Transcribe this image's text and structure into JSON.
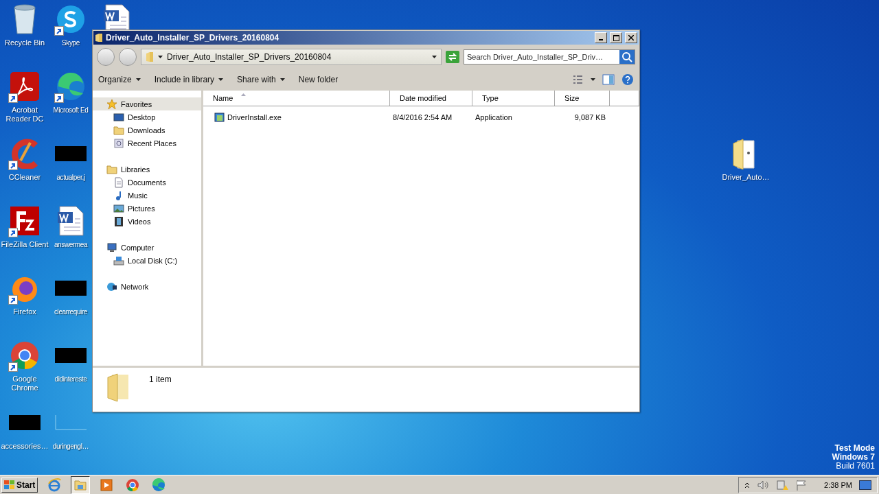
{
  "desktop": {
    "columns": [
      [
        {
          "label": "Recycle Bin",
          "kind": "recycle",
          "shortcut": false
        },
        {
          "label": "Acrobat Reader DC",
          "kind": "acrobat",
          "shortcut": true
        },
        {
          "label": "CCleaner",
          "kind": "ccleaner",
          "shortcut": true
        },
        {
          "label": "FileZilla Client",
          "kind": "filezilla",
          "shortcut": true
        },
        {
          "label": "Firefox",
          "kind": "firefox",
          "shortcut": true
        },
        {
          "label": "Google Chrome",
          "kind": "chrome",
          "shortcut": true
        },
        {
          "label": "accessories…",
          "kind": "image",
          "shortcut": false
        }
      ],
      [
        {
          "label": "Skype",
          "kind": "skype",
          "shortcut": true
        },
        {
          "label": "Microsoft Ed",
          "kind": "edge",
          "shortcut": true
        },
        {
          "label": "actualper.j",
          "kind": "image",
          "shortcut": false
        },
        {
          "label": "answermea",
          "kind": "word",
          "shortcut": false
        },
        {
          "label": "clearrequire",
          "kind": "image",
          "shortcut": false
        },
        {
          "label": "didintereste",
          "kind": "image",
          "shortcut": false
        },
        {
          "label": "duringengl…",
          "kind": "blank",
          "shortcut": false
        }
      ],
      [
        {
          "kind": "word",
          "shortcut": false
        }
      ]
    ],
    "right_icon": {
      "label": "Driver_Auto…",
      "kind": "folder",
      "shortcut": false
    },
    "system_text": [
      "Test Mode",
      "Windows 7",
      "Build 7601"
    ]
  },
  "window": {
    "title": "Driver_Auto_Installer_SP_Drivers_20160804",
    "address": "Driver_Auto_Installer_SP_Drivers_20160804",
    "search": {
      "placeholder": "Search Driver_Auto_Installer_SP_Driv…"
    },
    "toolbar": [
      {
        "label": "Organize",
        "dropdown": true
      },
      {
        "label": "Include in library",
        "dropdown": true
      },
      {
        "label": "Share with",
        "dropdown": true
      },
      {
        "label": "New folder",
        "dropdown": false
      }
    ],
    "nav": [
      {
        "label": "Favorites",
        "kind": "star",
        "selected": true,
        "children": [
          {
            "label": "Desktop",
            "kind": "desktop",
            "selected": false
          },
          {
            "label": "Downloads",
            "kind": "downloads",
            "selected": false
          },
          {
            "label": "Recent Places",
            "kind": "recent",
            "selected": false
          }
        ]
      },
      {
        "label": "Libraries",
        "kind": "libraries",
        "selected": false,
        "children": [
          {
            "label": "Documents",
            "kind": "documents",
            "selected": false
          },
          {
            "label": "Music",
            "kind": "music",
            "selected": false
          },
          {
            "label": "Pictures",
            "kind": "pictures",
            "selected": false
          },
          {
            "label": "Videos",
            "kind": "videos",
            "selected": false
          }
        ]
      },
      {
        "label": "Computer",
        "kind": "computer",
        "selected": false,
        "children": [
          {
            "label": "Local Disk (C:)",
            "kind": "disk",
            "selected": false
          }
        ]
      },
      {
        "label": "Network",
        "kind": "network",
        "selected": false
      }
    ],
    "columns": [
      {
        "label": "Name",
        "sorted": true
      },
      {
        "label": "Date modified",
        "sorted": false
      },
      {
        "label": "Type",
        "sorted": false
      },
      {
        "label": "Size",
        "sorted": false
      }
    ],
    "rows": [
      {
        "name": "DriverInstall.exe",
        "date": "8/4/2016 2:54 AM",
        "type": "Application",
        "size": "9,087 KB"
      }
    ],
    "status": "1 item"
  },
  "taskbar": {
    "start": "Start",
    "apps": [
      {
        "kind": "ie",
        "selected": false
      },
      {
        "kind": "explorer",
        "selected": true
      },
      {
        "kind": "media",
        "selected": false
      },
      {
        "kind": "chrome",
        "selected": false
      },
      {
        "kind": "edge",
        "selected": false
      }
    ],
    "clock": "2:38 PM"
  }
}
